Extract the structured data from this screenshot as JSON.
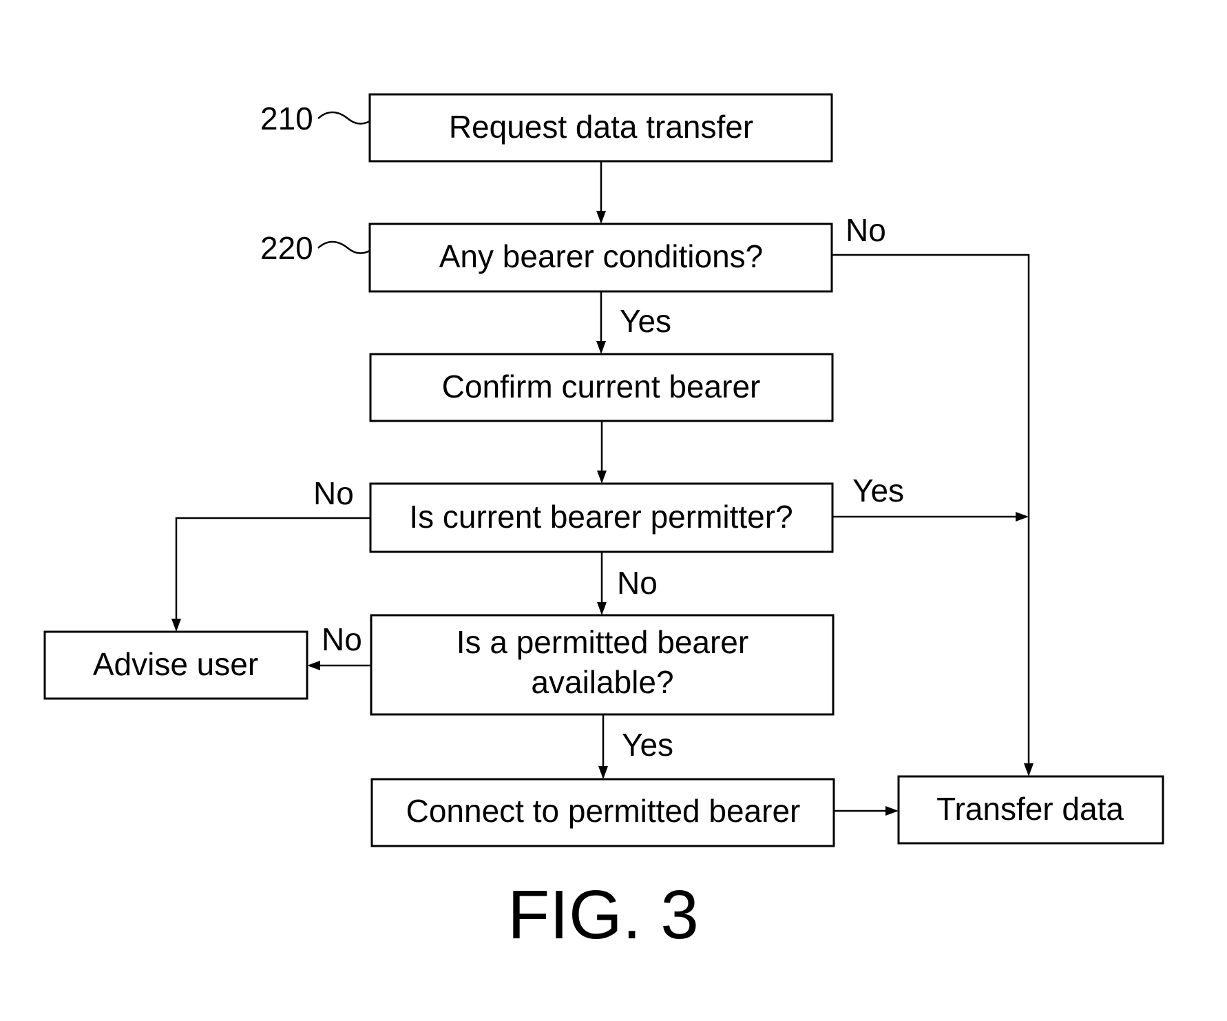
{
  "figure": {
    "caption": "FIG. 3",
    "reference_numerals": [
      "210",
      "220"
    ],
    "steps": {
      "request": "Request data transfer",
      "conditions": "Any bearer conditions?",
      "confirm": "Confirm current bearer",
      "permitted": "Is current bearer permitter?",
      "available_line1": "Is a permitted bearer",
      "available_line2": "available?",
      "connect": "Connect to permitted bearer",
      "advise": "Advise user",
      "transfer": "Transfer data"
    },
    "edge_labels": {
      "conditions_no": "No",
      "conditions_yes": "Yes",
      "permitted_no_left": "No",
      "permitted_yes": "Yes",
      "permitted_no_down": "No",
      "available_no": "No",
      "available_yes": "Yes"
    }
  }
}
